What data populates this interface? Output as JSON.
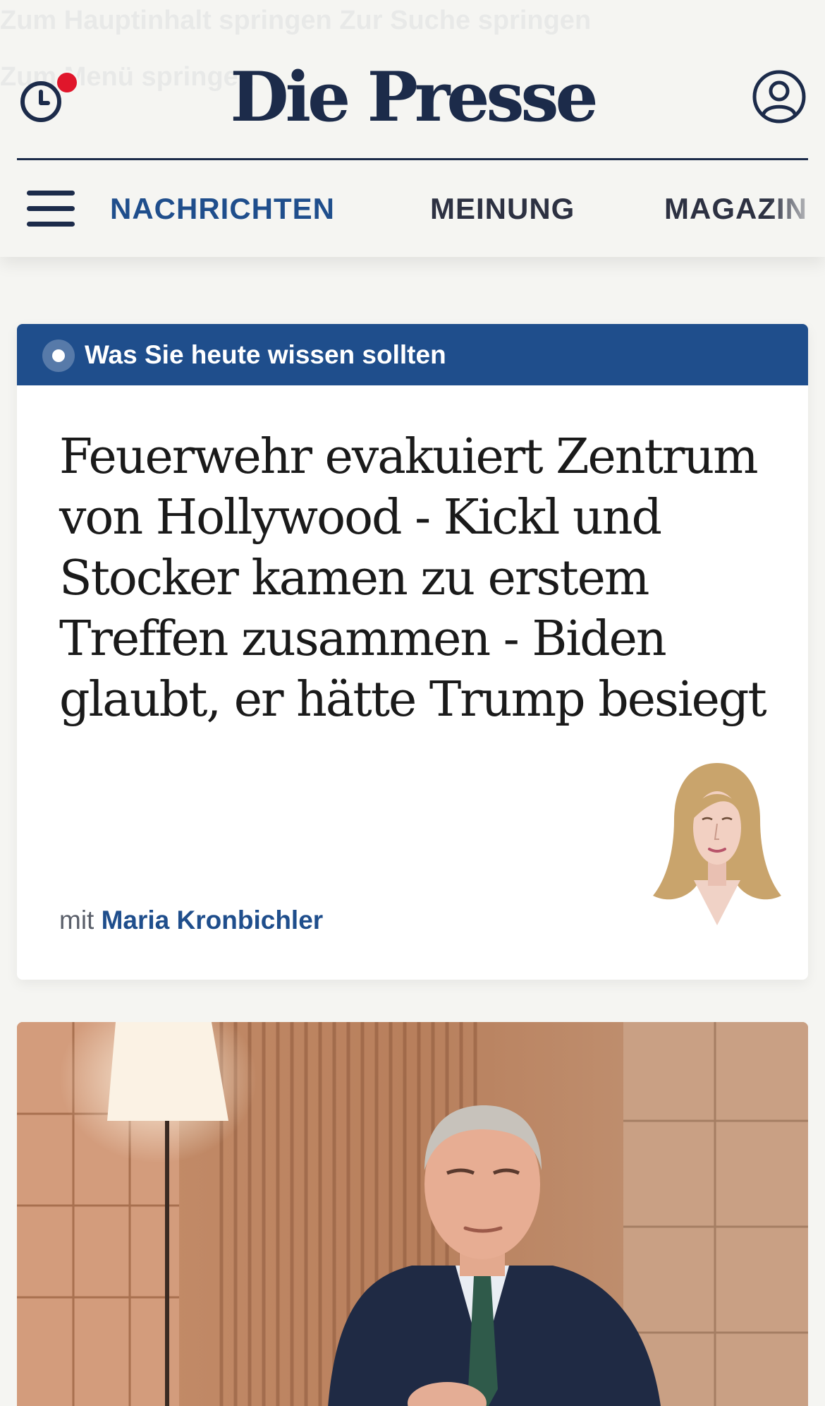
{
  "header": {
    "ghost_line_1": "Zum Hauptinhalt springen     Zur Suche springen",
    "ghost_line_2": "Zum Menü springen",
    "logo": "Die Presse",
    "history_icon": "clock-icon",
    "account_icon": "user-icon",
    "menu_icon": "hamburger-icon"
  },
  "nav": {
    "items": [
      {
        "label": "NACHRICHTEN"
      },
      {
        "label": "MEINUNG"
      },
      {
        "label": "MAGAZIN"
      }
    ]
  },
  "briefing": {
    "bar_label": "Was Sie heute wissen sollten",
    "headline": "Feuerwehr evakuiert Zentrum von Hollywood - Kickl und Stocker kamen zu erstem Treffen zusammen - Biden glaubt, er hätte Trump besiegt",
    "byline_prefix": "mit",
    "byline_author": "Maria Kronbichler"
  },
  "colors": {
    "brand_navy": "#1c2b4a",
    "accent_blue": "#1f4e8c",
    "notification_red": "#e0162b",
    "background": "#f5f5f2"
  }
}
